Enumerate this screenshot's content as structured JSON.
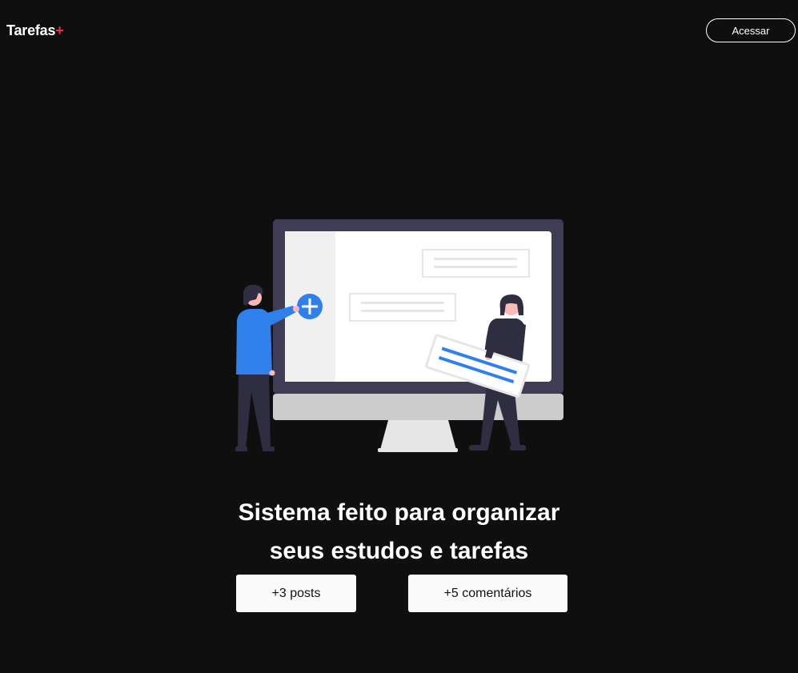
{
  "header": {
    "logo_text": "Tarefas",
    "logo_plus": "+",
    "login_label": "Acessar"
  },
  "hero": {
    "illustration": "person-adding-tasks-to-computer-screen",
    "headline_line1": "Sistema feito para organizar",
    "headline_line2": "seus estudos e tarefas"
  },
  "stats": {
    "posts": "+3 posts",
    "comments": "+5 comentários"
  },
  "colors": {
    "background": "#0f0f0f",
    "accent": "#ea3140",
    "illustration_blue": "#2f80ed",
    "stat_box": "#fafafa"
  }
}
